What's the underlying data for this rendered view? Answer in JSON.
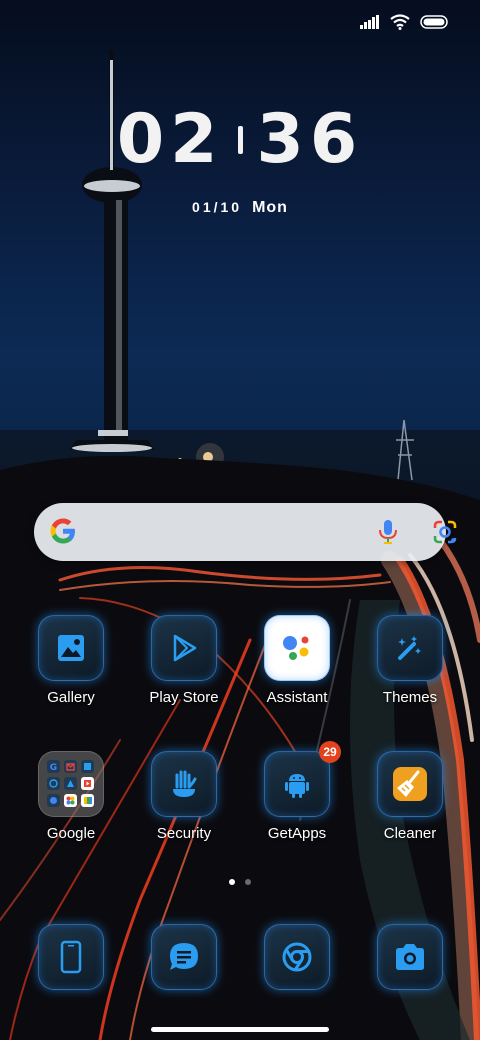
{
  "status": {
    "icons": [
      "signal-icon",
      "wifi-icon",
      "battery-icon"
    ]
  },
  "clock": {
    "hours": "02",
    "minutes": "36",
    "date": "01/10",
    "day": "Mon"
  },
  "search": {
    "icons": [
      "google-logo-icon",
      "mic-icon",
      "google-lens-icon"
    ]
  },
  "apps": {
    "gallery": {
      "label": "Gallery",
      "icon": "gallery-icon"
    },
    "play_store": {
      "label": "Play Store",
      "icon": "play-store-icon"
    },
    "assistant": {
      "label": "Assistant",
      "icon": "assistant-icon"
    },
    "themes": {
      "label": "Themes",
      "icon": "magic-wand-icon"
    },
    "google": {
      "label": "Google",
      "icon": "google-folder-icon"
    },
    "security": {
      "label": "Security",
      "icon": "security-icon"
    },
    "getapps": {
      "label": "GetApps",
      "icon": "android-icon",
      "badge": "29"
    },
    "cleaner": {
      "label": "Cleaner",
      "icon": "broom-icon"
    }
  },
  "pager": {
    "pages": 2,
    "active": 1
  },
  "dock": [
    "phone-icon",
    "messages-icon",
    "chrome-icon",
    "camera-icon"
  ],
  "colors": {
    "badge": "#e4421d",
    "tile_glow": "#3aa0ff",
    "cleaner": "#f0a020"
  }
}
